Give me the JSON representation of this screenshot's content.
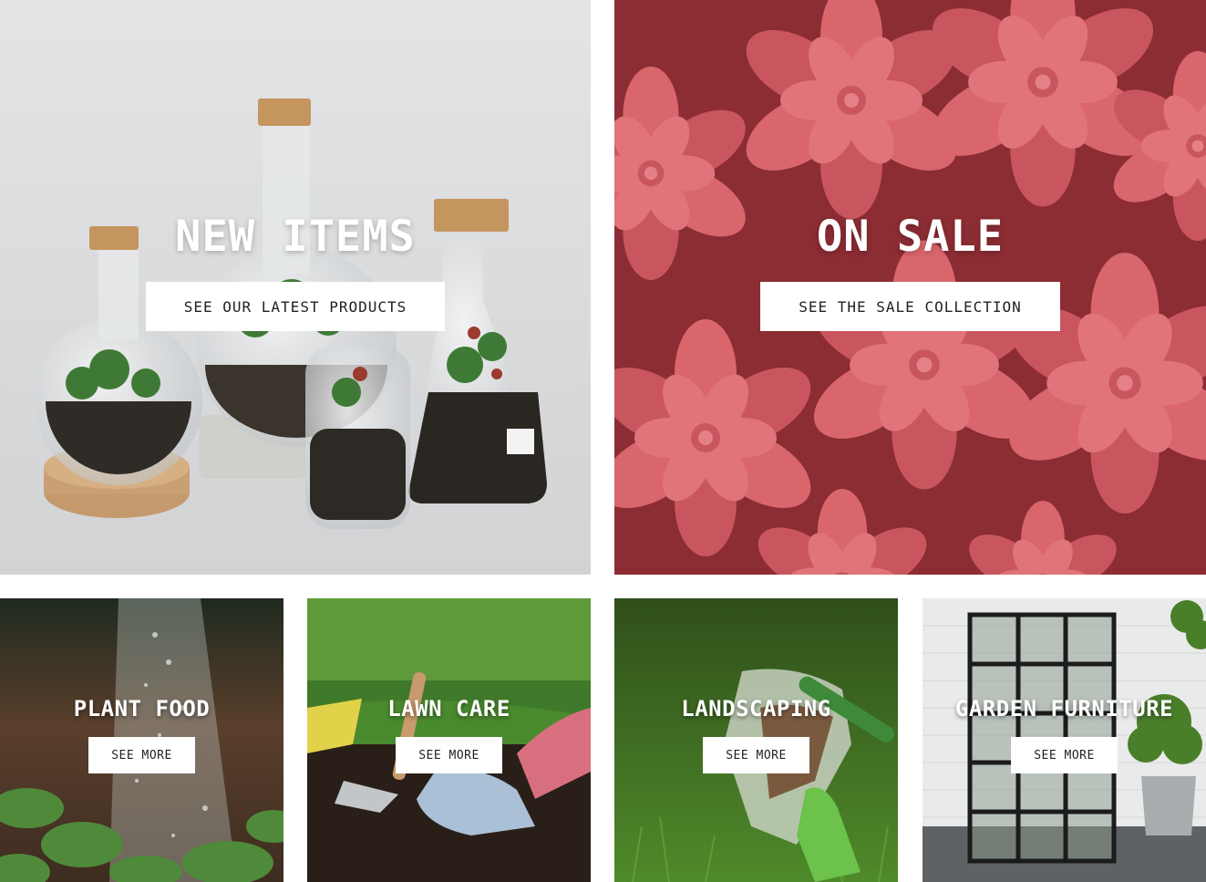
{
  "hero": {
    "new_items": {
      "title": "NEW ITEMS",
      "button": "SEE OUR LATEST PRODUCTS"
    },
    "on_sale": {
      "title": "ON SALE",
      "button": "SEE THE SALE COLLECTION"
    }
  },
  "categories": [
    {
      "title": "PLANT FOOD",
      "button": "SEE MORE"
    },
    {
      "title": "LAWN CARE",
      "button": "SEE MORE"
    },
    {
      "title": "LANDSCAPING",
      "button": "SEE MORE"
    },
    {
      "title": "GARDEN FURNITURE",
      "button": "SEE MORE"
    }
  ],
  "colors": {
    "sale_overlay": "#8c2c33",
    "sale_petal": "#d86a70",
    "new_bg": "#dedfe1",
    "button_bg": "#ffffff",
    "button_text": "#222222"
  }
}
